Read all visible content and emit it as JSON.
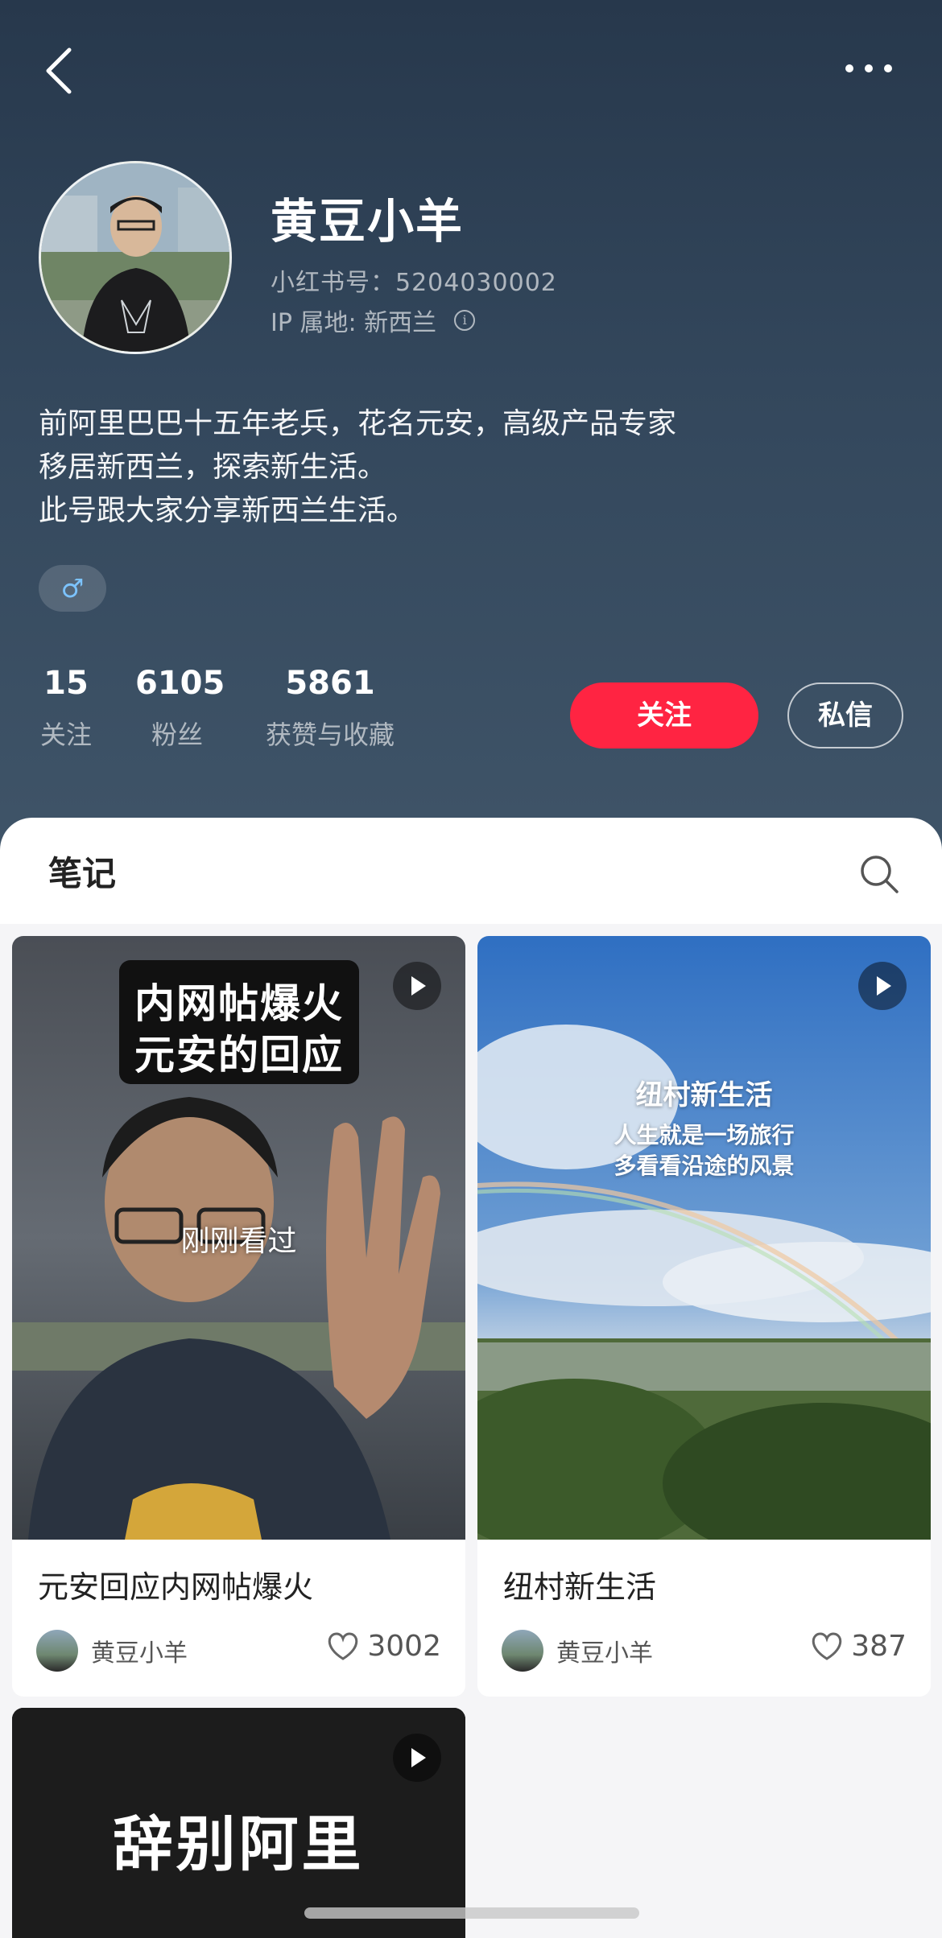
{
  "header": {
    "nickname": "黄豆小羊",
    "red_id": "小红书号：5204030002",
    "ip_location": "IP 属地: 新西兰",
    "bio": [
      "前阿里巴巴十五年老兵，花名元安，高级产品专家",
      "移居新西兰，探索新生活。",
      "此号跟大家分享新西兰生活。"
    ],
    "gender_symbol": "♂",
    "stats": [
      {
        "value": "15",
        "label": "关注"
      },
      {
        "value": "6105",
        "label": "粉丝"
      },
      {
        "value": "5861",
        "label": "获赞与收藏"
      }
    ],
    "follow_label": "关注",
    "message_label": "私信"
  },
  "tabs": {
    "notes_label": "笔记"
  },
  "cards": [
    {
      "cover_line1": "内网帖爆火",
      "cover_line2": "元安的回应",
      "overlay": "刚刚看过",
      "title": "元安回应内网帖爆火",
      "author": "黄豆小羊",
      "likes": "3002"
    },
    {
      "cover_heading": "纽村新生活",
      "cover_line1": "人生就是一场旅行",
      "cover_line2": "多看看沿途的风景",
      "title": "纽村新生活",
      "author": "黄豆小羊",
      "likes": "387"
    },
    {
      "cover_heading": "辞别阿里"
    }
  ],
  "colors": {
    "accent": "#ff2442",
    "header_bg": "#2d4055"
  },
  "icons": [
    "back-arrow-icon",
    "more-dots-icon",
    "info-icon",
    "male-icon",
    "search-icon",
    "play-icon",
    "heart-icon"
  ]
}
